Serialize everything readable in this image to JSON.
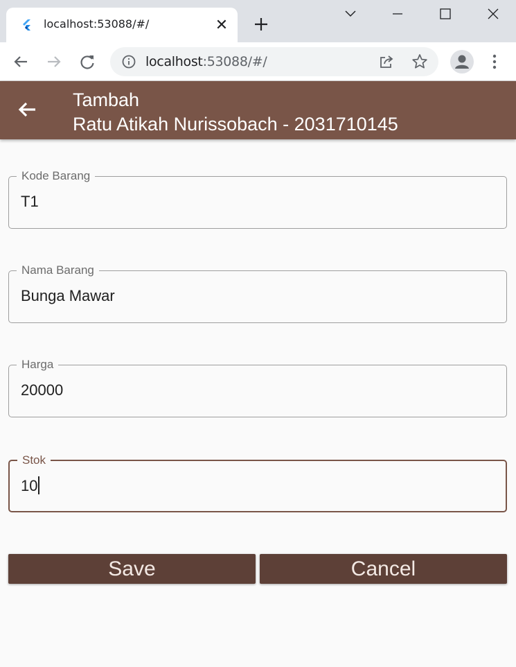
{
  "browser": {
    "tab_title": "localhost:53088/#/",
    "url_host": "localhost",
    "url_path": ":53088/#/"
  },
  "appbar": {
    "title_line1": "Tambah",
    "title_line2": "Ratu Atikah Nurissobach - 2031710145"
  },
  "form": {
    "kode_barang": {
      "label": "Kode Barang",
      "value": "T1"
    },
    "nama_barang": {
      "label": "Nama Barang",
      "value": "Bunga Mawar"
    },
    "harga": {
      "label": "Harga",
      "value": "20000"
    },
    "stok": {
      "label": "Stok",
      "value": "10"
    }
  },
  "buttons": {
    "save_label": "Save",
    "cancel_label": "Cancel"
  },
  "colors": {
    "appbar": "#795548",
    "button": "#5d4037",
    "focus_border": "#795548"
  },
  "icons": {
    "back": "arrow-back-icon",
    "favicon": "flutter-logo-icon"
  }
}
